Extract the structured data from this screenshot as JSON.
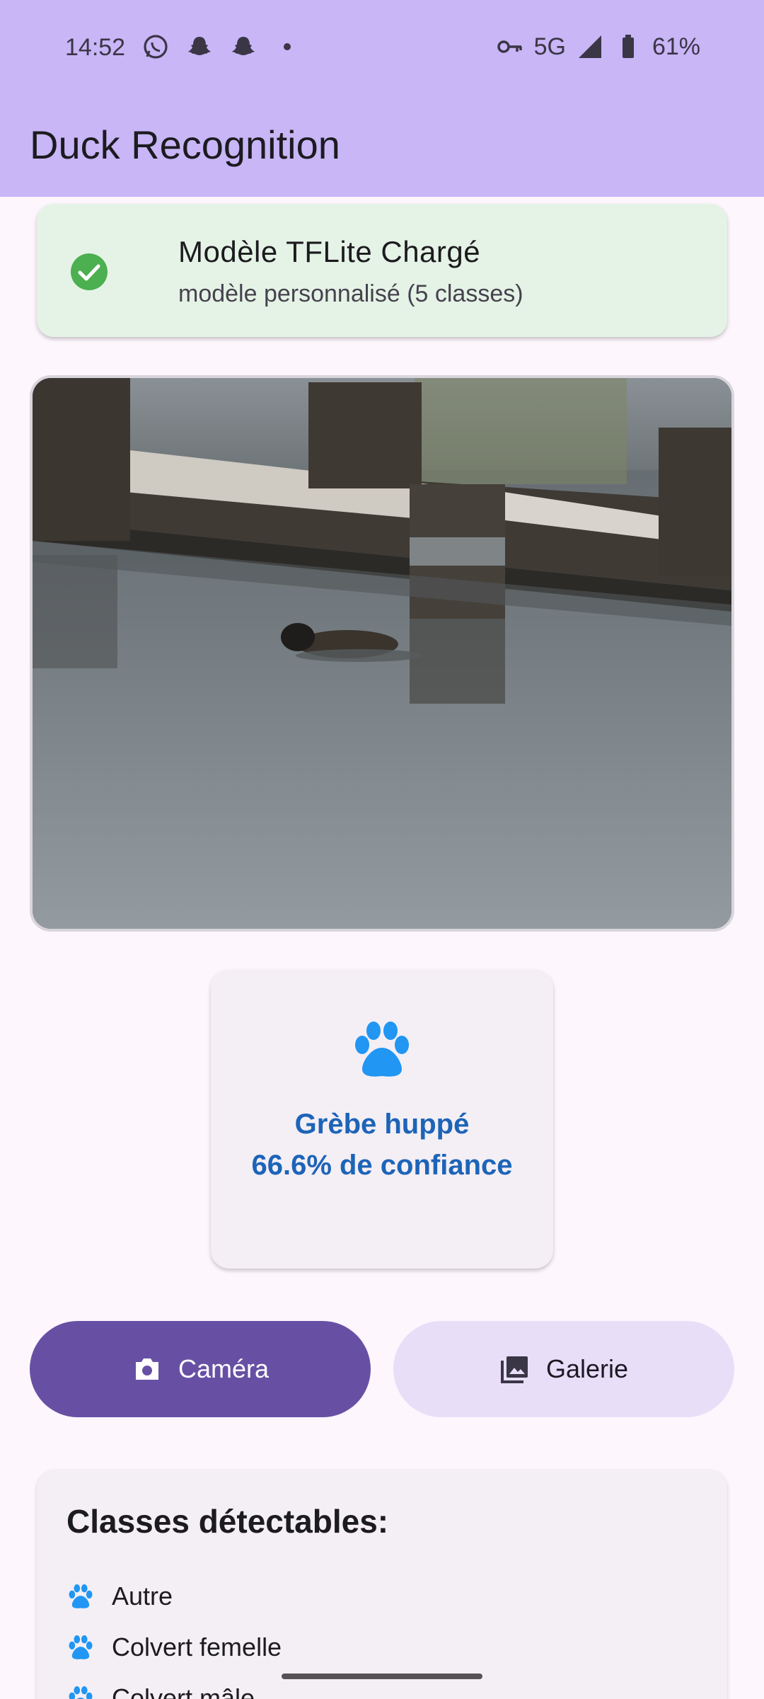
{
  "status_bar": {
    "time": "14:52",
    "network": "5G",
    "battery": "61%",
    "left_icons": [
      "whatsapp-icon",
      "snapchat-icon",
      "snapchat-icon",
      "dot-icon"
    ],
    "right_icons": [
      "key-icon",
      "signal-icon",
      "battery-icon"
    ]
  },
  "app_bar": {
    "title": "Duck Recognition",
    "color": "#c8b6f7"
  },
  "model_status": {
    "title": "Modèle TFLite Chargé",
    "subtitle": "modèle personnalisé (5 classes)",
    "icon": "check-circle-icon",
    "color": "#4caf50"
  },
  "result": {
    "icon": "paw-icon",
    "species": "Grèbe huppé",
    "confidence": "66.6% de confiance",
    "color": "#1d64b8"
  },
  "actions": {
    "camera_label": "Caméra",
    "gallery_label": "Galerie",
    "camera_icon": "camera-icon",
    "gallery_icon": "image-icon",
    "primary_color": "#6750a4"
  },
  "classes": {
    "heading": "Classes détectables:",
    "items": [
      {
        "label": "Autre"
      },
      {
        "label": "Colvert femelle"
      },
      {
        "label": "Colvert mâle"
      }
    ]
  }
}
